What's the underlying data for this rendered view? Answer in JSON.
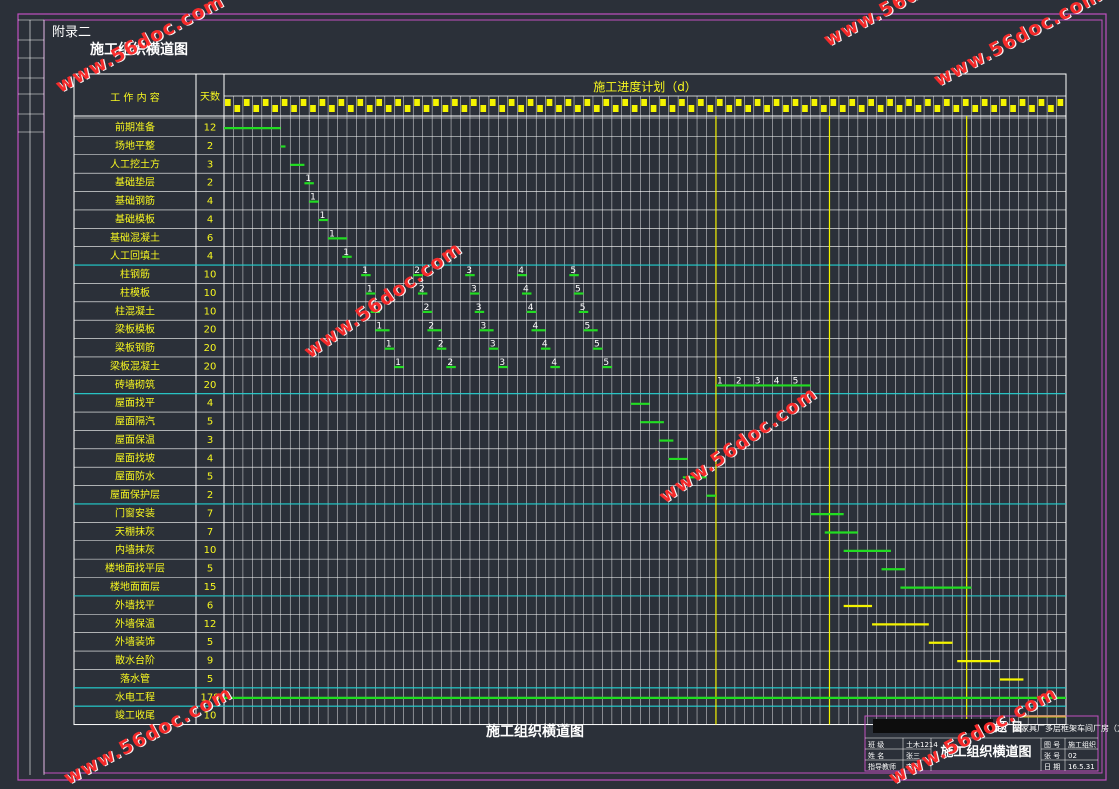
{
  "appendix": "附录二",
  "sheet_title": "施工组织横道图",
  "header": {
    "work_content": "工 作 内 容",
    "days": "天数",
    "schedule": "施工进度计划（d）"
  },
  "tasks": [
    {
      "name": "前期准备",
      "days": "12"
    },
    {
      "name": "场地平整",
      "days": "2"
    },
    {
      "name": "人工挖土方",
      "days": "3"
    },
    {
      "name": "基础垫层",
      "days": "2"
    },
    {
      "name": "基础钢筋",
      "days": "4"
    },
    {
      "name": "基础模板",
      "days": "4"
    },
    {
      "name": "基础混凝土",
      "days": "6"
    },
    {
      "name": "人工回填土",
      "days": "4"
    },
    {
      "name": "柱钢筋",
      "days": "10"
    },
    {
      "name": "柱模板",
      "days": "10"
    },
    {
      "name": "柱混凝土",
      "days": "10"
    },
    {
      "name": "梁板模板",
      "days": "20"
    },
    {
      "name": "梁板钢筋",
      "days": "20"
    },
    {
      "name": "梁板混凝土",
      "days": "20"
    },
    {
      "name": "砖墙砌筑",
      "days": "20"
    },
    {
      "name": "屋面找平",
      "days": "4"
    },
    {
      "name": "屋面隔汽",
      "days": "5"
    },
    {
      "name": "屋面保温",
      "days": "3"
    },
    {
      "name": "屋面找坡",
      "days": "4"
    },
    {
      "name": "屋面防水",
      "days": "5"
    },
    {
      "name": "屋面保护层",
      "days": "2"
    },
    {
      "name": "门窗安装",
      "days": "7"
    },
    {
      "name": "天棚抹灰",
      "days": "7"
    },
    {
      "name": "内墙抹灰",
      "days": "10"
    },
    {
      "name": "楼地面找平层",
      "days": "5"
    },
    {
      "name": "楼地面面层",
      "days": "15"
    },
    {
      "name": "外墙找平",
      "days": "6"
    },
    {
      "name": "外墙保温",
      "days": "12"
    },
    {
      "name": "外墙装饰",
      "days": "5"
    },
    {
      "name": "散水台阶",
      "days": "9"
    },
    {
      "name": "落水管",
      "days": "5"
    },
    {
      "name": "水电工程",
      "days": "178"
    },
    {
      "name": "竣工收尾",
      "days": "10"
    }
  ],
  "bars": [
    {
      "row": 0,
      "s": 0,
      "e": 12,
      "c": "green"
    },
    {
      "row": 1,
      "s": 12,
      "e": 13,
      "c": "green"
    },
    {
      "row": 2,
      "s": 14,
      "e": 17,
      "c": "green"
    },
    {
      "row": 3,
      "s": 17,
      "e": 19,
      "c": "green",
      "l": "1"
    },
    {
      "row": 4,
      "s": 18,
      "e": 20,
      "c": "green",
      "l": "1"
    },
    {
      "row": 5,
      "s": 20,
      "e": 22,
      "c": "green",
      "l": "1"
    },
    {
      "row": 6,
      "s": 22,
      "e": 26,
      "c": "green",
      "l": "1"
    },
    {
      "row": 7,
      "s": 25,
      "e": 27,
      "c": "green",
      "l": "1"
    },
    {
      "row": 8,
      "s": 29,
      "e": 31,
      "c": "green",
      "l": "1"
    },
    {
      "row": 9,
      "s": 30,
      "e": 32,
      "c": "green",
      "l": "1"
    },
    {
      "row": 10,
      "s": 31,
      "e": 33,
      "c": "green",
      "l": "1"
    },
    {
      "row": 11,
      "s": 32,
      "e": 35,
      "c": "green",
      "l": "1"
    },
    {
      "row": 12,
      "s": 34,
      "e": 36,
      "c": "green",
      "l": "1"
    },
    {
      "row": 13,
      "s": 36,
      "e": 38,
      "c": "green",
      "l": "1"
    },
    {
      "row": 8,
      "s": 40,
      "e": 42,
      "c": "green",
      "l": "2"
    },
    {
      "row": 9,
      "s": 41,
      "e": 43,
      "c": "green",
      "l": "2"
    },
    {
      "row": 10,
      "s": 42,
      "e": 44,
      "c": "green",
      "l": "2"
    },
    {
      "row": 11,
      "s": 43,
      "e": 46,
      "c": "green",
      "l": "2"
    },
    {
      "row": 12,
      "s": 45,
      "e": 47,
      "c": "green",
      "l": "2"
    },
    {
      "row": 13,
      "s": 47,
      "e": 49,
      "c": "green",
      "l": "2"
    },
    {
      "row": 8,
      "s": 51,
      "e": 53,
      "c": "green",
      "l": "3"
    },
    {
      "row": 9,
      "s": 52,
      "e": 54,
      "c": "green",
      "l": "3"
    },
    {
      "row": 10,
      "s": 53,
      "e": 55,
      "c": "green",
      "l": "3"
    },
    {
      "row": 11,
      "s": 54,
      "e": 57,
      "c": "green",
      "l": "3"
    },
    {
      "row": 12,
      "s": 56,
      "e": 58,
      "c": "green",
      "l": "3"
    },
    {
      "row": 13,
      "s": 58,
      "e": 60,
      "c": "green",
      "l": "3"
    },
    {
      "row": 8,
      "s": 62,
      "e": 64,
      "c": "green",
      "l": "4"
    },
    {
      "row": 9,
      "s": 63,
      "e": 65,
      "c": "green",
      "l": "4"
    },
    {
      "row": 10,
      "s": 64,
      "e": 66,
      "c": "green",
      "l": "4"
    },
    {
      "row": 11,
      "s": 65,
      "e": 68,
      "c": "green",
      "l": "4"
    },
    {
      "row": 12,
      "s": 67,
      "e": 69,
      "c": "green",
      "l": "4"
    },
    {
      "row": 13,
      "s": 69,
      "e": 71,
      "c": "green",
      "l": "4"
    },
    {
      "row": 8,
      "s": 73,
      "e": 75,
      "c": "green",
      "l": "5"
    },
    {
      "row": 9,
      "s": 74,
      "e": 76,
      "c": "green",
      "l": "5"
    },
    {
      "row": 10,
      "s": 75,
      "e": 77,
      "c": "green",
      "l": "5"
    },
    {
      "row": 11,
      "s": 76,
      "e": 79,
      "c": "green",
      "l": "5"
    },
    {
      "row": 12,
      "s": 78,
      "e": 80,
      "c": "green",
      "l": "5"
    },
    {
      "row": 13,
      "s": 80,
      "e": 82,
      "c": "green",
      "l": "5"
    },
    {
      "row": 14,
      "s": 104,
      "e": 108,
      "c": "green",
      "l": "1"
    },
    {
      "row": 14,
      "s": 108,
      "e": 112,
      "c": "green",
      "l": "2"
    },
    {
      "row": 14,
      "s": 112,
      "e": 116,
      "c": "green",
      "l": "3"
    },
    {
      "row": 14,
      "s": 116,
      "e": 120,
      "c": "green",
      "l": "4"
    },
    {
      "row": 14,
      "s": 120,
      "e": 124,
      "c": "green",
      "l": "5"
    },
    {
      "row": 15,
      "s": 86,
      "e": 90,
      "c": "green"
    },
    {
      "row": 16,
      "s": 88,
      "e": 93,
      "c": "green"
    },
    {
      "row": 17,
      "s": 92,
      "e": 95,
      "c": "green"
    },
    {
      "row": 18,
      "s": 94,
      "e": 98,
      "c": "green"
    },
    {
      "row": 19,
      "s": 97,
      "e": 102,
      "c": "green"
    },
    {
      "row": 20,
      "s": 102,
      "e": 104,
      "c": "green"
    },
    {
      "row": 21,
      "s": 124,
      "e": 131,
      "c": "green"
    },
    {
      "row": 22,
      "s": 127,
      "e": 134,
      "c": "green"
    },
    {
      "row": 23,
      "s": 131,
      "e": 141,
      "c": "green"
    },
    {
      "row": 24,
      "s": 139,
      "e": 144,
      "c": "green"
    },
    {
      "row": 25,
      "s": 143,
      "e": 158,
      "c": "green"
    },
    {
      "row": 26,
      "s": 131,
      "e": 137,
      "c": "yellow"
    },
    {
      "row": 27,
      "s": 137,
      "e": 149,
      "c": "yellow"
    },
    {
      "row": 28,
      "s": 149,
      "e": 154,
      "c": "yellow"
    },
    {
      "row": 29,
      "s": 155,
      "e": 164,
      "c": "yellow"
    },
    {
      "row": 30,
      "s": 164,
      "e": 169,
      "c": "yellow"
    },
    {
      "row": 31,
      "s": 0,
      "e": 178,
      "c": "green"
    },
    {
      "row": 32,
      "s": 168,
      "e": 178,
      "c": "yellow"
    }
  ],
  "title_block": {
    "center_caption": "施工组织横道图",
    "project_label": "题 目",
    "project_name": "某家具厂多层框架车间厂房（方案一）",
    "drawing_name": "施工组织横道图",
    "left_rows": [
      {
        "k": "班 级",
        "v": "土木1214"
      },
      {
        "k": "姓 名",
        "v": "张三"
      },
      {
        "k": "指导教师",
        "v": "李四"
      }
    ],
    "right_rows": [
      {
        "k": "图 号",
        "v": "施工组织"
      },
      {
        "k": "张 号",
        "v": "02"
      },
      {
        "k": "日 期",
        "v": "16.5.31"
      }
    ]
  },
  "watermark": "www.56doc.com",
  "colors": {
    "background": "#2b3039",
    "grid": "#ffffff",
    "bar_green": "#22dd22",
    "bar_yellow": "#f4f400",
    "divider_cyan": "#20d0d0",
    "frame": "#c050c0",
    "label_yellow": "#f8f820",
    "watermark": "#ff2a2a"
  }
}
